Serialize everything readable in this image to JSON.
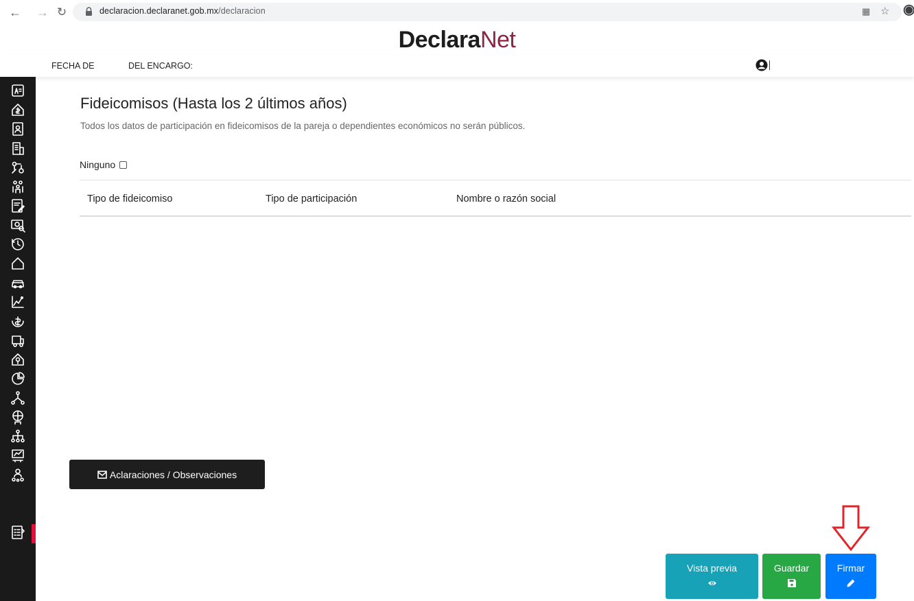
{
  "browser": {
    "url_host": "declaracion.declaranet.gob.mx",
    "url_path": "/declaracion"
  },
  "brand": {
    "part1": "Declara",
    "part2": "Net"
  },
  "infobar": {
    "fecha_label": "FECHA DE",
    "encargo_label": "DEL ENCARGO:"
  },
  "main": {
    "title": "Fideicomisos (Hasta los 2 últimos años)",
    "subtitle": "Todos los datos de participación en fideicomisos de la pareja o dependientes económicos no serán públicos.",
    "ninguno_label": "Ninguno",
    "columns": [
      "Tipo de fideicomiso",
      "Tipo de participación",
      "Nombre o razón social"
    ]
  },
  "aclaraciones_label": "Aclaraciones / Observaciones",
  "actions": {
    "preview": "Vista previa",
    "save": "Guardar",
    "sign": "Firmar"
  },
  "sidebar": {
    "icons": [
      "id-card-icon",
      "house-money-icon",
      "document-person-icon",
      "building-icon",
      "connections-icon",
      "family-icon",
      "edit-document-icon",
      "money-search-icon",
      "history-icon",
      "home-icon",
      "car-icon",
      "chart-line-icon",
      "hand-money-icon",
      "truck-icon",
      "house-pin-icon",
      "pie-chart-icon",
      "hierarchy-icon",
      "globe-people-icon",
      "organization-icon",
      "board-chart-icon",
      "people-network-icon",
      "checklist-icon"
    ]
  },
  "colors": {
    "sidebar": "#1a1a1a",
    "active": "#e2103a",
    "brand_net": "#8c2544",
    "preview": "#17a2b8",
    "save": "#28a745",
    "sign": "#007bff",
    "arrow": "#e2232a"
  }
}
